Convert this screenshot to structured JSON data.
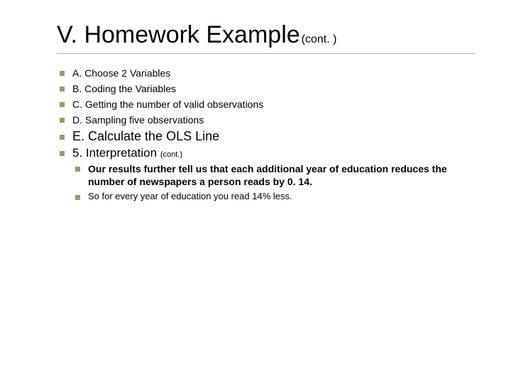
{
  "title": "V. Homework Example",
  "title_cont": "(cont. )",
  "steps": {
    "a": "A. Choose 2 Variables",
    "b": "B. Coding the Variables",
    "c": "C. Getting the number of valid observations",
    "d": "D. Sampling five observations"
  },
  "main_step": "E. Calculate the OLS Line",
  "interp": {
    "label": "5. Interpretation",
    "cont": "(cont.)",
    "result": "Our results further tell us that each additional year of education reduces the number of newspapers a person reads by 0. 14.",
    "sub": "So for every year of education you read 14% less."
  }
}
